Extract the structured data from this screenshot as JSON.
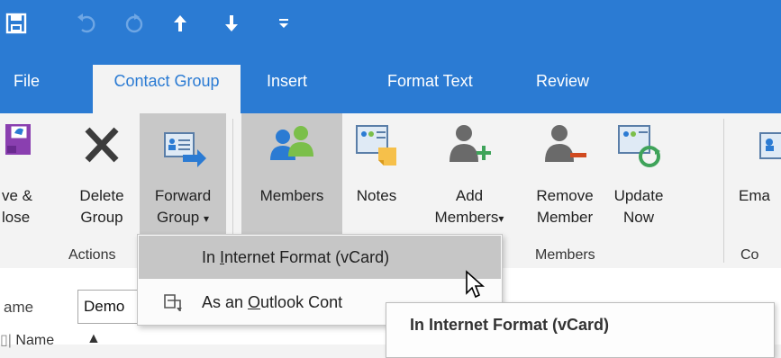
{
  "qat": {
    "icons": [
      "save-icon",
      "undo-icon",
      "redo-icon",
      "up-arrow-icon",
      "down-arrow-icon",
      "customize-icon"
    ]
  },
  "tabs": [
    {
      "label": "File"
    },
    {
      "label": "Contact Group"
    },
    {
      "label": "Insert"
    },
    {
      "label": "Format Text"
    },
    {
      "label": "Review"
    }
  ],
  "ribbon": {
    "actions": {
      "group_label": "Actions",
      "save_close": {
        "line1": "ve &",
        "line2": "lose"
      },
      "delete": {
        "line1": "Delete",
        "line2": "Group"
      },
      "forward": {
        "line1": "Forward",
        "line2": "Group"
      }
    },
    "members_group": {
      "group_label": "Members",
      "members": {
        "line1": "Members"
      },
      "notes": {
        "line1": "Notes"
      },
      "add": {
        "line1": "Add",
        "line2": "Members"
      },
      "remove": {
        "line1": "Remove",
        "line2": "Member"
      },
      "update": {
        "line1": "Update",
        "line2": "Now"
      }
    },
    "comm": {
      "line1": "Ema",
      "group_label": "Co"
    }
  },
  "dropdown": {
    "items": [
      {
        "prefix": "In ",
        "underline": "I",
        "rest": "nternet Format (vCard)"
      },
      {
        "prefix": "As an ",
        "underline": "O",
        "rest": "utlook Cont"
      }
    ]
  },
  "tooltip": {
    "text": "In Internet Format (vCard)"
  },
  "form": {
    "name_label": "ame",
    "name_value": "Demo",
    "column_header": "Name"
  },
  "colors": {
    "brand_blue": "#2b7bd3",
    "ribbon_bg": "#f3f3f3"
  }
}
